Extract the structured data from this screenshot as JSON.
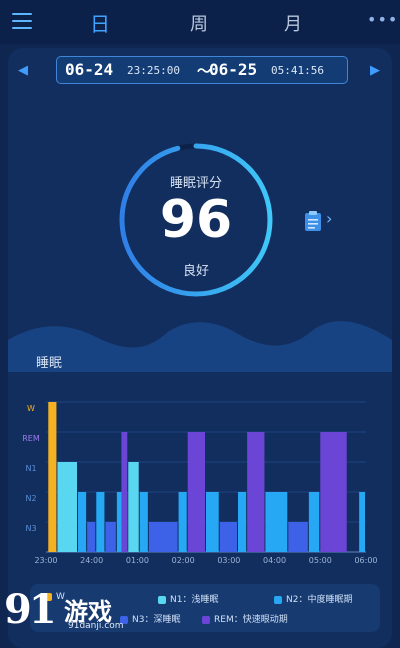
{
  "topbar": {
    "tabs": [
      {
        "label": "日",
        "active": true
      },
      {
        "label": "周",
        "active": false
      },
      {
        "label": "月",
        "active": false
      }
    ],
    "more_icon": "more-icon",
    "menu_icon": "menu-icon"
  },
  "date_range": {
    "start_date": "06-24",
    "start_time": "23:25:00",
    "separator": "〜",
    "end_date": "06-25",
    "end_time": "05:41:56"
  },
  "score": {
    "label": "睡眠评分",
    "value": "96",
    "rating": "良好",
    "progress_percent": 96
  },
  "section": {
    "label": "睡眠"
  },
  "chart_data": {
    "type": "bar",
    "y_levels": [
      "W",
      "REM",
      "N1",
      "N2",
      "N3"
    ],
    "x_ticks": [
      "23:00",
      "24:00",
      "01:00",
      "02:00",
      "03:00",
      "04:00",
      "05:00",
      "06:00"
    ],
    "x_range": [
      23.0,
      30.0
    ],
    "series": [
      {
        "name": "W",
        "color": "#f4b223",
        "segments": [
          [
            23.05,
            23.25
          ]
        ]
      },
      {
        "name": "N1",
        "color": "#5ad7f0",
        "segments": [
          [
            23.25,
            23.7
          ],
          [
            24.8,
            25.05
          ]
        ]
      },
      {
        "name": "N2",
        "color": "#27a8f5",
        "segments": [
          [
            23.7,
            23.9
          ],
          [
            24.1,
            24.3
          ],
          [
            24.55,
            24.8
          ],
          [
            25.05,
            25.25
          ],
          [
            25.9,
            26.1
          ],
          [
            26.5,
            26.8
          ],
          [
            27.2,
            27.4
          ],
          [
            27.8,
            28.3
          ],
          [
            28.75,
            29.0
          ],
          [
            29.85,
            30.0
          ]
        ]
      },
      {
        "name": "N3",
        "color": "#3d62e8",
        "segments": [
          [
            23.9,
            24.1
          ],
          [
            24.3,
            24.55
          ],
          [
            25.25,
            25.9
          ],
          [
            26.8,
            27.2
          ],
          [
            28.3,
            28.75
          ]
        ]
      },
      {
        "name": "REM",
        "color": "#6b46d6",
        "segments": [
          [
            24.65,
            24.8
          ],
          [
            26.1,
            26.5
          ],
          [
            27.4,
            27.8
          ],
          [
            29.0,
            29.6
          ]
        ]
      }
    ]
  },
  "legend": {
    "items": [
      {
        "label": "W",
        "color": "#f4b223"
      },
      {
        "label": "N1：浅睡眠",
        "color": "#5ad7f0"
      },
      {
        "label": "N2：中度睡眠期",
        "color": "#27a8f5"
      },
      {
        "label": "N3：深睡眠",
        "color": "#3d62e8"
      },
      {
        "label": "REM：快速眼动期",
        "color": "#6b46d6"
      }
    ]
  },
  "watermark": {
    "logo": "91",
    "brand": "游戏",
    "url": "91danji.com"
  },
  "colors": {
    "accent": "#3fa3ff",
    "background": "#0f2650",
    "card": "#122e5e"
  }
}
